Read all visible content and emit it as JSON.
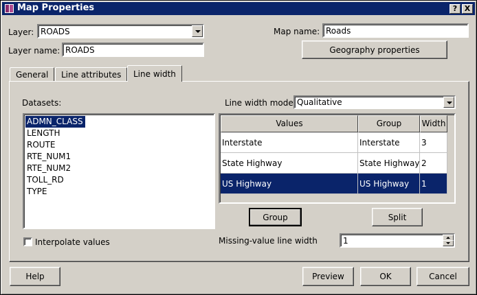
{
  "window": {
    "title": "Map Properties",
    "help_glyph": "?",
    "close_glyph": "X"
  },
  "top": {
    "layer_label": "Layer:",
    "layer_value": "ROADS",
    "layer_name_label": "Layer name:",
    "layer_name_value": "ROADS",
    "map_name_label": "Map name:",
    "map_name_value": "Roads",
    "geography_button": "Geography properties"
  },
  "tabs": [
    {
      "label": "General",
      "active": false
    },
    {
      "label": "Line attributes",
      "active": false
    },
    {
      "label": "Line width",
      "active": true
    }
  ],
  "datasets": {
    "label": "Datasets:",
    "items": [
      "ADMN_CLASS",
      "LENGTH",
      "ROUTE",
      "RTE_NUM1",
      "RTE_NUM2",
      "TOLL_RD",
      "TYPE"
    ],
    "selected": "ADMN_CLASS"
  },
  "interpolate": {
    "label": "Interpolate values",
    "checked": false
  },
  "mode": {
    "label": "Line width mode",
    "value": "Qualitative"
  },
  "grid": {
    "columns": [
      "Values",
      "Group",
      "Width"
    ],
    "rows": [
      {
        "value": "Interstate",
        "group": "Interstate",
        "width": "3",
        "selected": false
      },
      {
        "value": "State Highway",
        "group": "State Highway",
        "width": "2",
        "selected": false
      },
      {
        "value": "US Highway",
        "group": "US Highway",
        "width": "1",
        "selected": true
      }
    ]
  },
  "group_button": "Group",
  "split_button": "Split",
  "missing": {
    "label": "Missing-value line width",
    "value": "1"
  },
  "footer": {
    "help": "Help",
    "preview": "Preview",
    "ok": "OK",
    "cancel": "Cancel"
  },
  "colors": {
    "titlebar": "#0a246a",
    "selection": "#0a246a",
    "face": "#d4d0c8"
  },
  "icons": {
    "app": "map-book-icon",
    "combo": "chevron-down-icon"
  }
}
